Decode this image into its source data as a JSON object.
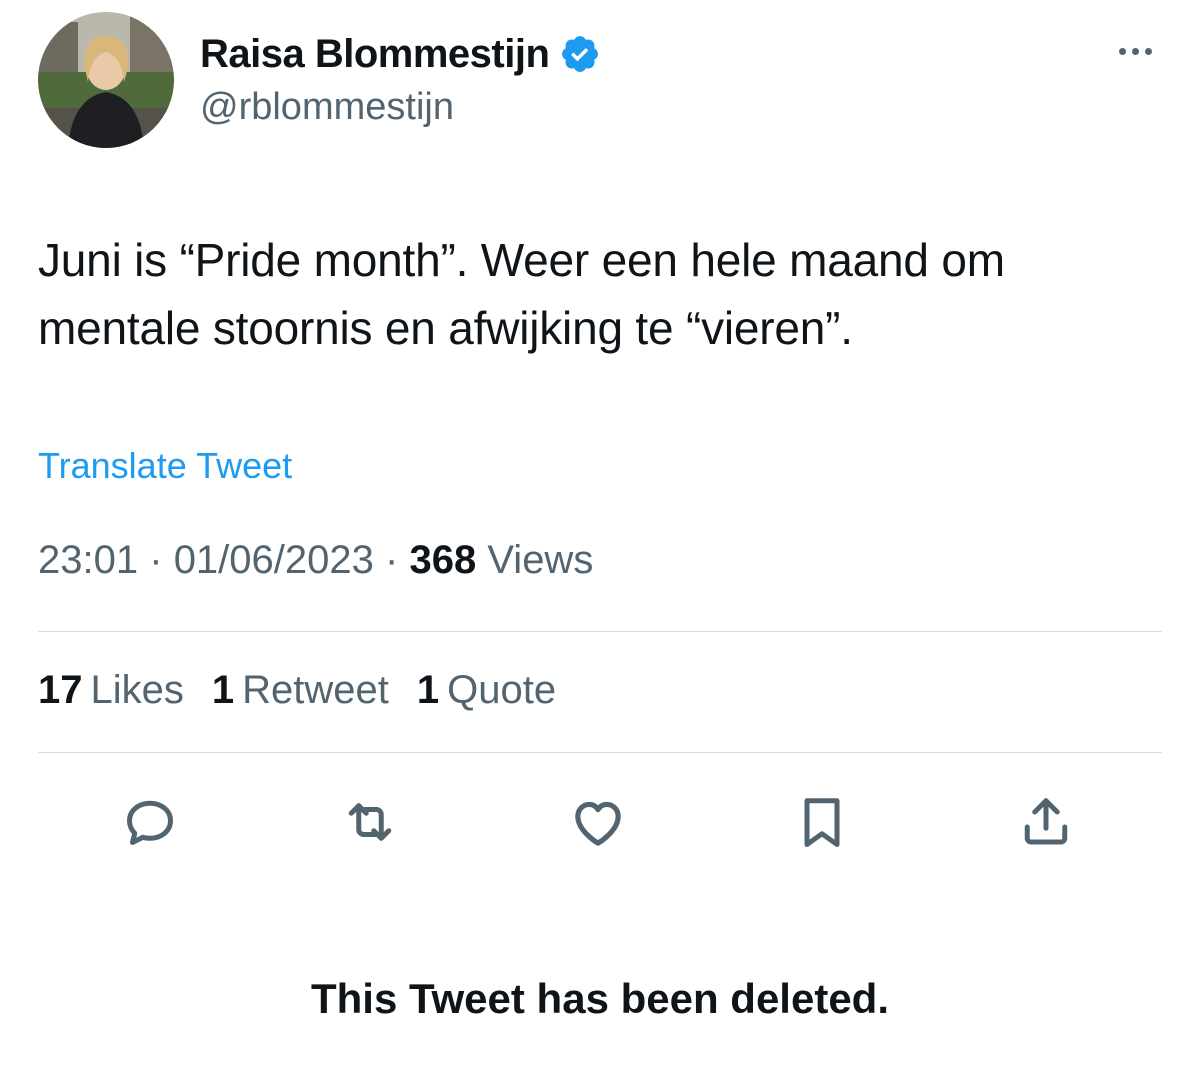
{
  "author": {
    "display_name": "Raisa Blommestijn",
    "handle": "@rblommestijn",
    "verified": true,
    "verified_color": "#1d9bf0"
  },
  "tweet": {
    "text": "Juni is “Pride month”. Weer een hele maand om mentale stoornis en afwijking te “vieren”.",
    "translate_label": "Translate Tweet",
    "time": "23:01",
    "date": "01/06/2023",
    "views_count": "368",
    "views_label": "Views",
    "separator": "·"
  },
  "stats": {
    "likes_count": "17",
    "likes_label": "Likes",
    "retweets_count": "1",
    "retweets_label": "Retweet",
    "quotes_count": "1",
    "quotes_label": "Quote"
  },
  "actions": [
    "reply-icon",
    "retweet-icon",
    "like-icon",
    "bookmark-icon",
    "share-icon"
  ],
  "notice": "This Tweet has been deleted.",
  "colors": {
    "text_primary": "#0f1419",
    "text_secondary": "#536471",
    "link": "#1d9bf0",
    "divider": "#d9dde1"
  }
}
